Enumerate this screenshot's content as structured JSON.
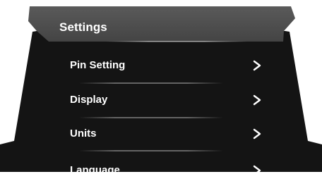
{
  "header": {
    "title": "Settings"
  },
  "menu": {
    "items": [
      {
        "label": "Pin Setting",
        "icon": "chevron-right-icon"
      },
      {
        "label": "Display",
        "icon": "chevron-right-icon"
      },
      {
        "label": "Units",
        "icon": "chevron-right-icon"
      },
      {
        "label": "Language",
        "icon": "chevron-right-icon"
      }
    ]
  },
  "colors": {
    "background": "#141414",
    "header": "#4d4d4d",
    "text": "#ffffff"
  }
}
